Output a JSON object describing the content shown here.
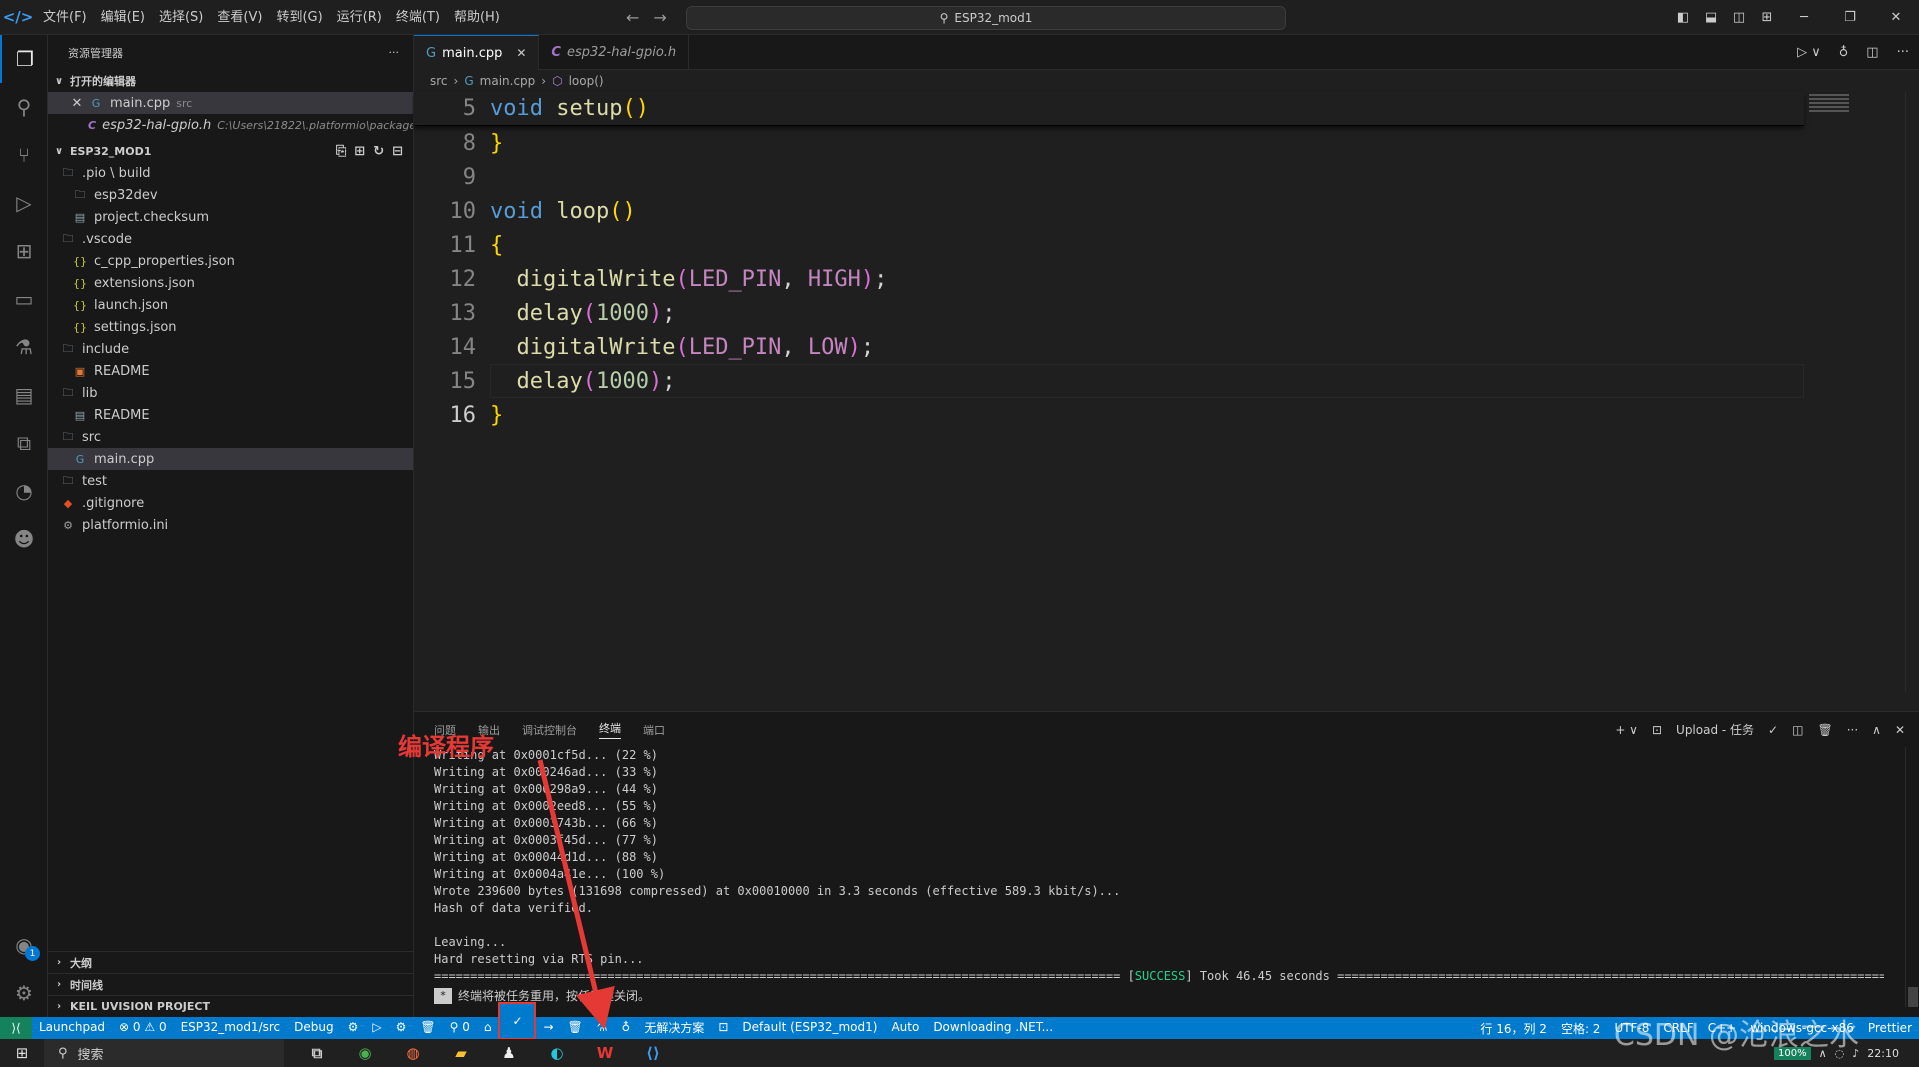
{
  "titlebar": {
    "menu": [
      "文件(F)",
      "编辑(E)",
      "选择(S)",
      "查看(V)",
      "转到(G)",
      "运行(R)",
      "终端(T)",
      "帮助(H)"
    ],
    "search": "ESP32_mod1"
  },
  "sidebar": {
    "title": "资源管理器",
    "open_editors_title": "打开的编辑器",
    "open_editors": [
      {
        "name": "main.cpp",
        "desc": "src"
      },
      {
        "name": "esp32-hal-gpio.h",
        "desc": "C:\\Users\\21822\\.platformio\\packages..."
      }
    ],
    "project_title": "ESP32_MOD1",
    "tree": [
      {
        "label": ".pio \\ build",
        "icon": "folder-icon",
        "indent": 0
      },
      {
        "label": "esp32dev",
        "icon": "folder-icon",
        "indent": 1
      },
      {
        "label": "project.checksum",
        "icon": "file-icon",
        "indent": 1
      },
      {
        "label": ".vscode",
        "icon": "folder-icon",
        "indent": 0
      },
      {
        "label": "c_cpp_properties.json",
        "icon": "json-icon",
        "indent": 1
      },
      {
        "label": "extensions.json",
        "icon": "json-icon",
        "indent": 1
      },
      {
        "label": "launch.json",
        "icon": "json-icon",
        "indent": 1
      },
      {
        "label": "settings.json",
        "icon": "json-icon",
        "indent": 1
      },
      {
        "label": "include",
        "icon": "folder-icon",
        "indent": 0
      },
      {
        "label": "README",
        "icon": "readme-icon",
        "indent": 1
      },
      {
        "label": "lib",
        "icon": "folder-icon",
        "indent": 0
      },
      {
        "label": "README",
        "icon": "file-icon",
        "indent": 1
      },
      {
        "label": "src",
        "icon": "folder-icon",
        "indent": 0
      },
      {
        "label": "main.cpp",
        "icon": "cpp-icon",
        "indent": 1,
        "selected": true
      },
      {
        "label": "test",
        "icon": "folder-icon",
        "indent": 0
      },
      {
        "label": ".gitignore",
        "icon": "git-icon",
        "indent": 0
      },
      {
        "label": "platformio.ini",
        "icon": "gear-file-icon",
        "indent": 0
      }
    ],
    "outline_title": "大纲",
    "timeline_title": "时间线",
    "keil_title": "KEIL UVISION PROJECT"
  },
  "editor": {
    "tabs": [
      {
        "label": "main.cpp",
        "active": true
      },
      {
        "label": "esp32-hal-gpio.h",
        "active": false
      }
    ],
    "breadcrumb": [
      "src",
      "main.cpp",
      "loop()"
    ],
    "lines": [
      {
        "num": "5",
        "tokens": [
          [
            "kw",
            "void"
          ],
          [
            "pun",
            " "
          ],
          [
            "fn",
            "setup"
          ],
          [
            "br",
            "()"
          ]
        ],
        "sticky": true
      },
      {
        "num": "8",
        "tokens": [
          [
            "br",
            "}"
          ]
        ]
      },
      {
        "num": "9",
        "tokens": []
      },
      {
        "num": "10",
        "tokens": [
          [
            "kw",
            "void"
          ],
          [
            "pun",
            " "
          ],
          [
            "fn",
            "loop"
          ],
          [
            "br",
            "()"
          ]
        ]
      },
      {
        "num": "11",
        "tokens": [
          [
            "br",
            "{"
          ]
        ]
      },
      {
        "num": "12",
        "tokens": [
          [
            "pun",
            "  "
          ],
          [
            "fn",
            "digitalWrite"
          ],
          [
            "br2",
            "("
          ],
          [
            "mac",
            "LED_PIN"
          ],
          [
            "pun",
            ", "
          ],
          [
            "mac",
            "HIGH"
          ],
          [
            "br2",
            ")"
          ],
          [
            "pun",
            ";"
          ]
        ]
      },
      {
        "num": "13",
        "tokens": [
          [
            "pun",
            "  "
          ],
          [
            "fn",
            "delay"
          ],
          [
            "br2",
            "("
          ],
          [
            "num",
            "1000"
          ],
          [
            "br2",
            ")"
          ],
          [
            "pun",
            ";"
          ]
        ]
      },
      {
        "num": "14",
        "tokens": [
          [
            "pun",
            "  "
          ],
          [
            "fn",
            "digitalWrite"
          ],
          [
            "br2",
            "("
          ],
          [
            "mac",
            "LED_PIN"
          ],
          [
            "pun",
            ", "
          ],
          [
            "mac",
            "LOW"
          ],
          [
            "br2",
            ")"
          ],
          [
            "pun",
            ";"
          ]
        ]
      },
      {
        "num": "15",
        "tokens": [
          [
            "pun",
            "  "
          ],
          [
            "fn",
            "delay"
          ],
          [
            "br2",
            "("
          ],
          [
            "num",
            "1000"
          ],
          [
            "br2",
            ")"
          ],
          [
            "pun",
            ";"
          ]
        ],
        "highlight": true
      },
      {
        "num": "16",
        "tokens": [
          [
            "br",
            "}"
          ]
        ],
        "current": true
      }
    ]
  },
  "panel": {
    "tabs": [
      "问题",
      "输出",
      "调试控制台",
      "终端",
      "端口"
    ],
    "active_tab": "终端",
    "task_label": "Upload - 任务",
    "terminal_lines": [
      "Writing at 0x0001cf5d... (22 %)",
      "Writing at 0x000246ad... (33 %)",
      "Writing at 0x000298a9... (44 %)",
      "Writing at 0x0002eed8... (55 %)",
      "Writing at 0x0003743b... (66 %)",
      "Writing at 0x0003f45d... (77 %)",
      "Writing at 0x00044d1d... (88 %)",
      "Writing at 0x0004a41e... (100 %)",
      "Wrote 239600 bytes (131698 compressed) at 0x00010000 in 3.3 seconds (effective 589.3 kbit/s)...",
      "Hash of data verified.",
      "",
      "Leaving...",
      "Hard resetting via RTS pin..."
    ],
    "success_prefix": "=============================================================================================== [",
    "success_word": "SUCCESS",
    "success_suffix": "] Took 46.45 seconds ===============================================================================================",
    "reuse_msg": "终端将被任务重用，按任意键关闭。"
  },
  "statusbar": {
    "left": [
      "Launchpad",
      "⊗ 0 ⚠ 0",
      "ESP32_mod1/src",
      "Debug",
      "⚙",
      "▷",
      "⚙",
      "🗑",
      "⚲ 0",
      "⌂",
      "✓",
      "→",
      "🗑",
      "⚗",
      "♁",
      "无解决方案",
      "⊡",
      "Default (ESP32_mod1)",
      "Auto",
      "Downloading .NET..."
    ],
    "right": [
      "行 16，列 2",
      "空格: 2",
      "UTF-8",
      "CRLF",
      "C++",
      "windows-gcc-x86",
      "Prettier"
    ]
  },
  "annotation": {
    "label": "编译程序"
  },
  "watermark": "CSDN @沧浪之水",
  "taskbar": {
    "search": "搜索",
    "battery": "100%",
    "time": "22:10"
  }
}
